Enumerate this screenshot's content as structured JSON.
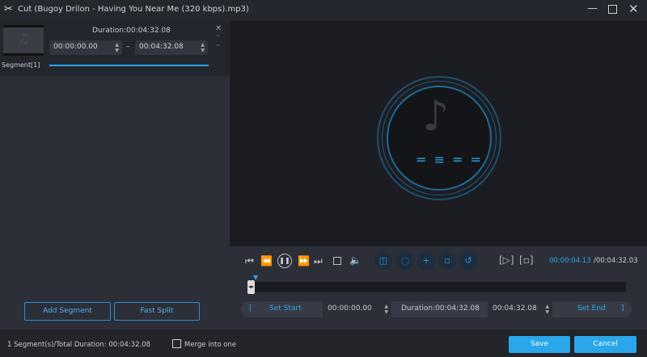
{
  "window": {
    "title": "Cut (Bugoy Drilon - Having You Near Me (320 kbps).mp3)"
  },
  "segment": {
    "label": "Segment[1]",
    "duration": "Duration:00:04:32.08",
    "start": "00:00:00.00",
    "end": "00:04:32.08",
    "separator": "–"
  },
  "left_buttons": {
    "add_segment": "Add Segment",
    "fast_split": "Fast Split"
  },
  "player": {
    "current_time": "00:00:04.13",
    "total_time": "/00:04:32.03",
    "progress": 0.015
  },
  "trim": {
    "set_start": "Set Start",
    "start": "00:00:00.00",
    "duration": "Duration:00:04:32.08",
    "end": "00:04:32.08",
    "set_end": "Set End",
    "bracket_open": "[",
    "bracket_close": "]"
  },
  "footer": {
    "summary": "1 Segment(s)/Total Duration: 00:04:32.08",
    "merge_label": "Merge into one",
    "merge_checked": false,
    "save": "Save",
    "cancel": "Cancel"
  },
  "colors": {
    "accent": "#2aa7ea"
  }
}
